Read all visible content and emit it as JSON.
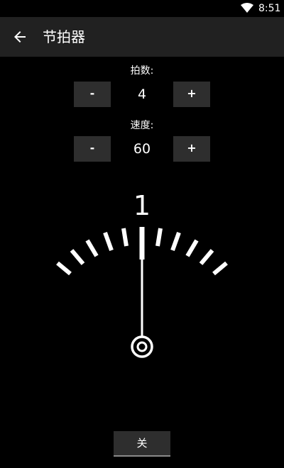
{
  "status_bar": {
    "time": "8:51",
    "wifi_icon": "wifi-icon"
  },
  "app_bar": {
    "back_icon": "arrow-back-icon",
    "title": "节拍器"
  },
  "beats": {
    "label": "拍数:",
    "decrement_label": "-",
    "value": "4",
    "increment_label": "+"
  },
  "tempo": {
    "label": "速度:",
    "decrement_label": "-",
    "value": "60",
    "increment_label": "+"
  },
  "metronome": {
    "current_beat": "1",
    "pendulum_position": 0,
    "scale_ticks_per_side": 5
  },
  "off_button": {
    "label": "关"
  },
  "colors": {
    "background": "#000000",
    "app_bar": "#212121",
    "button": "#2e2e2e",
    "foreground": "#ffffff"
  }
}
